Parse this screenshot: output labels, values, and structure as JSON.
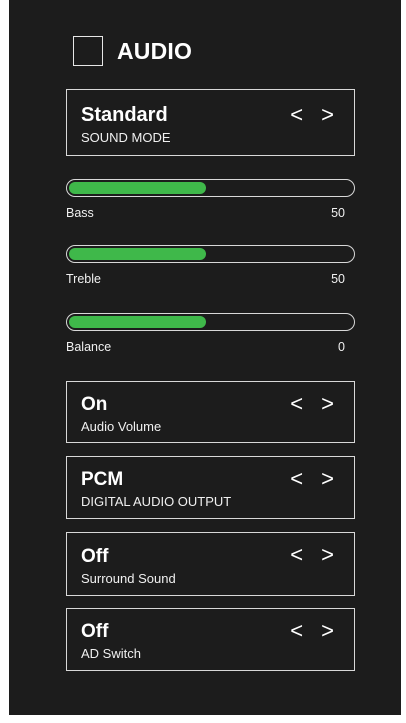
{
  "screen": {
    "title": "AUDIO"
  },
  "colors": {
    "background": "#1c1c1c",
    "slider_fill": "#3fb84a",
    "border": "#d8d8d8",
    "text": "#ffffff"
  },
  "sound_mode": {
    "value": "Standard",
    "label": "SOUND MODE",
    "arrows": "< >"
  },
  "sliders": [
    {
      "label": "Bass",
      "value": "50",
      "fill_fraction": 0.48
    },
    {
      "label": "Treble",
      "value": "50",
      "fill_fraction": 0.48
    },
    {
      "label": "Balance",
      "value": "0",
      "fill_fraction": 0.48
    }
  ],
  "options": [
    {
      "value": "On",
      "label": "Audio Volume",
      "arrows": "< >"
    },
    {
      "value": "PCM",
      "label": "DIGITAL AUDIO OUTPUT",
      "arrows": "< >"
    },
    {
      "value": "Off",
      "label": "Surround Sound",
      "arrows": "< >"
    },
    {
      "value": "Off",
      "label": "AD Switch",
      "arrows": "< >"
    }
  ]
}
